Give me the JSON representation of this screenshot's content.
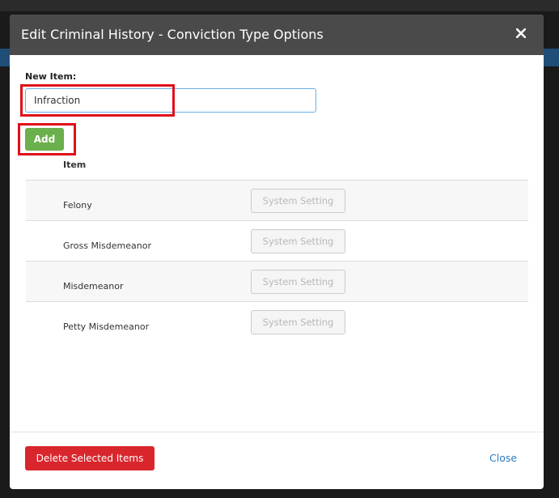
{
  "modal": {
    "title": "Edit Criminal History - Conviction Type Options",
    "close_glyph": "×",
    "close_icon": "close-icon"
  },
  "form": {
    "new_item_label": "New Item:",
    "new_item_value": "Infraction",
    "add_label": "Add"
  },
  "table": {
    "column_header": "Item",
    "rows": [
      {
        "label": "Felony",
        "action": "System Setting"
      },
      {
        "label": "Gross Misdemeanor",
        "action": "System Setting"
      },
      {
        "label": "Misdemeanor",
        "action": "System Setting"
      },
      {
        "label": "Petty Misdemeanor",
        "action": "System Setting"
      }
    ]
  },
  "footer": {
    "delete_label": "Delete Selected Items",
    "close_label": "Close"
  },
  "colors": {
    "header_bg": "#4a4a4a",
    "add_green": "#6ab04c",
    "delete_red": "#d9262c",
    "link_blue": "#2a7dc0",
    "highlight_red": "#e0101a"
  }
}
